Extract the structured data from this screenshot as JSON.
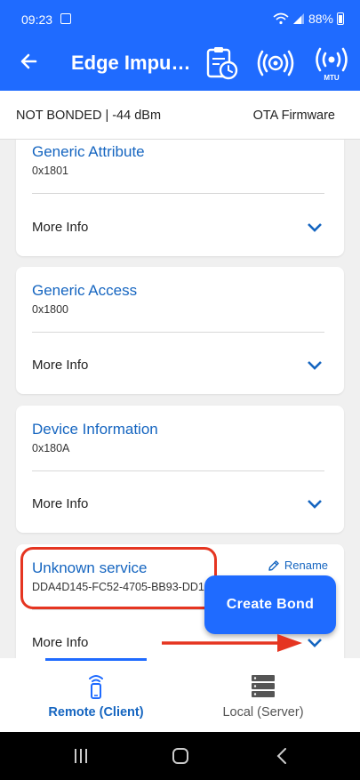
{
  "status_bar": {
    "time": "09:23",
    "battery": "88%"
  },
  "app_bar": {
    "title": "Edge Impu…",
    "icons": [
      "back-arrow-icon",
      "log-clipboard-icon",
      "rssi-broadcast-icon",
      "mtu-icon"
    ],
    "mtu_label": "MTU"
  },
  "info_bar": {
    "status": "NOT BONDED | -44 dBm",
    "ota": "OTA Firmware"
  },
  "services": [
    {
      "name": "Generic Attribute",
      "uuid": "0x1801",
      "more": "More Info"
    },
    {
      "name": "Generic Access",
      "uuid": "0x1800",
      "more": "More Info"
    },
    {
      "name": "Device Information",
      "uuid": "0x180A",
      "more": "More Info"
    },
    {
      "name": "Unknown service",
      "uuid": "DDA4D145-FC52-4705-BB93-DD1",
      "more": "More Info",
      "rename": "Rename"
    }
  ],
  "create_bond": "Create Bond",
  "bottom_nav": {
    "tabs": [
      {
        "label": "Remote (Client)",
        "active": true
      },
      {
        "label": "Local (Server)",
        "active": false
      }
    ]
  },
  "colors": {
    "primary": "#1f6bff",
    "link": "#1565c0",
    "annotation": "#e53521"
  }
}
